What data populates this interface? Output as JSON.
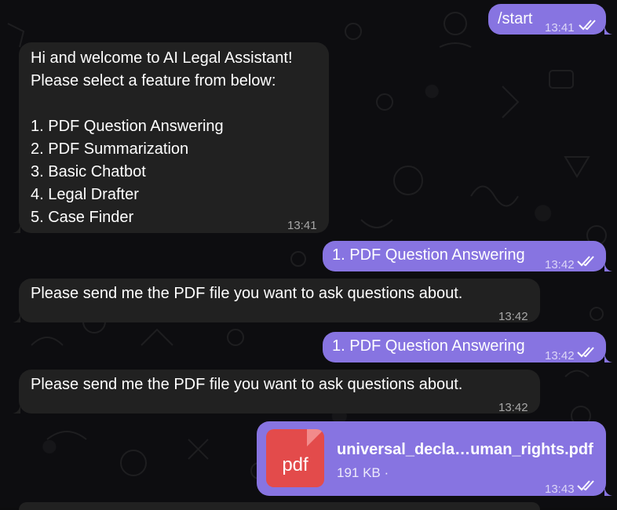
{
  "messages": [
    {
      "dir": "out",
      "text": "/start",
      "time": "13:41",
      "read": true
    },
    {
      "dir": "in",
      "lines": [
        "Hi and welcome to AI Legal Assistant!",
        "Please select a feature from below:",
        "",
        "1. PDF Question Answering",
        "2. PDF Summarization",
        "3. Basic Chatbot",
        "4. Legal Drafter",
        "5. Case Finder"
      ],
      "time": "13:41"
    },
    {
      "dir": "out",
      "text": "1. PDF Question Answering",
      "time": "13:42",
      "read": true
    },
    {
      "dir": "in",
      "text": "Please send me the PDF file you want to ask questions about.",
      "time": "13:42"
    },
    {
      "dir": "out",
      "text": "1. PDF Question Answering",
      "time": "13:42",
      "read": true
    },
    {
      "dir": "in",
      "text": "Please send me the PDF file you want to ask questions about.",
      "time": "13:42"
    },
    {
      "dir": "out",
      "file": {
        "icon_label": "pdf",
        "name": "universal_decla…uman_rights.pdf",
        "size": "191 KB ·"
      },
      "time": "13:43",
      "read": true
    }
  ],
  "colors": {
    "incoming_bubble": "#212121",
    "outgoing_bubble": "#8774e1",
    "file_icon": "#e34b4b",
    "background": "#0d0d10"
  },
  "icons": {
    "read_receipt": "double-check-icon",
    "file": "pdf-file-icon"
  }
}
